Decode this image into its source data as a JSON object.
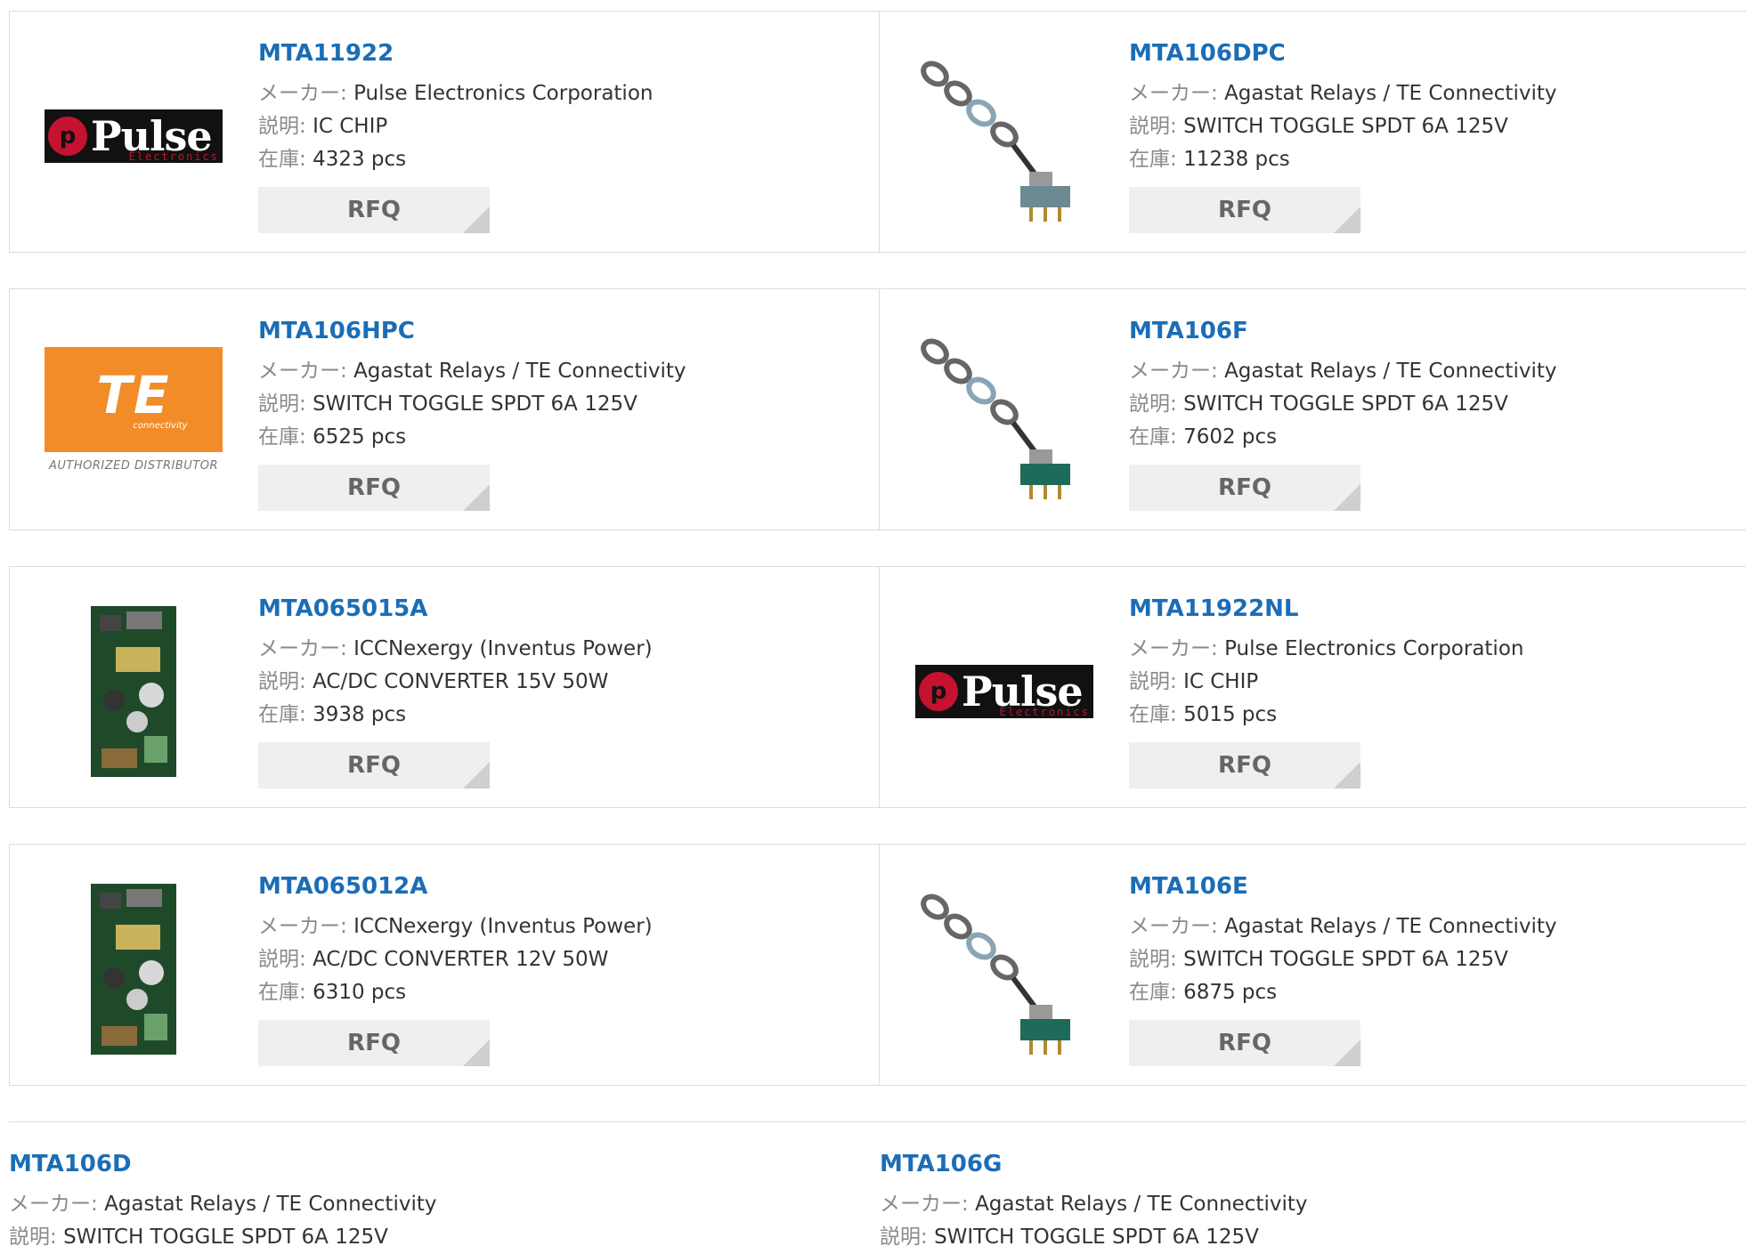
{
  "labels": {
    "maker": "メーカー:",
    "desc": "説明:",
    "stock": "在庫:",
    "rfq": "RFQ"
  },
  "products": [
    {
      "pn": "MTA11922",
      "maker": "Pulse Electronics Corporation",
      "desc": "IC CHIP",
      "stock": "4323 pcs",
      "thumb": "pulse-logo",
      "thumb_text": "Pulse",
      "thumb_sub": "Electronics"
    },
    {
      "pn": "MTA106DPC",
      "maker": "Agastat Relays / TE Connectivity",
      "desc": "SWITCH TOGGLE SPDT 6A 125V",
      "stock": "11238 pcs",
      "thumb": "toggle-switch-photo-gray"
    },
    {
      "pn": "MTA106HPC",
      "maker": "Agastat Relays / TE Connectivity",
      "desc": "SWITCH TOGGLE SPDT 6A 125V",
      "stock": "6525 pcs",
      "thumb": "te-logo",
      "thumb_text": "TE",
      "thumb_sub": "connectivity",
      "thumb_caption": "AUTHORIZED DISTRIBUTOR"
    },
    {
      "pn": "MTA106F",
      "maker": "Agastat Relays / TE Connectivity",
      "desc": "SWITCH TOGGLE SPDT 6A 125V",
      "stock": "7602 pcs",
      "thumb": "toggle-switch-photo-green"
    },
    {
      "pn": "MTA065015A",
      "maker": "ICCNexergy (Inventus Power)",
      "desc": "AC/DC CONVERTER 15V 50W",
      "stock": "3938 pcs",
      "thumb": "pcb-photo"
    },
    {
      "pn": "MTA11922NL",
      "maker": "Pulse Electronics Corporation",
      "desc": "IC CHIP",
      "stock": "5015 pcs",
      "thumb": "pulse-logo",
      "thumb_text": "Pulse",
      "thumb_sub": "Electronics"
    },
    {
      "pn": "MTA065012A",
      "maker": "ICCNexergy (Inventus Power)",
      "desc": "AC/DC CONVERTER 12V 50W",
      "stock": "6310 pcs",
      "thumb": "pcb-photo"
    },
    {
      "pn": "MTA106E",
      "maker": "Agastat Relays / TE Connectivity",
      "desc": "SWITCH TOGGLE SPDT 6A 125V",
      "stock": "6875 pcs",
      "thumb": "toggle-switch-photo-green"
    },
    {
      "pn": "MTA106D",
      "maker": "Agastat Relays / TE Connectivity",
      "desc": "SWITCH TOGGLE SPDT 6A 125V",
      "stock": "",
      "thumb": ""
    },
    {
      "pn": "MTA106G",
      "maker": "Agastat Relays / TE Connectivity",
      "desc": "SWITCH TOGGLE SPDT 6A 125V",
      "stock": "",
      "thumb": ""
    }
  ],
  "colors": {
    "link": "#1b6db6",
    "border": "#dcdcdc",
    "rfq_bg": "#efefef",
    "pulse_red": "#c41230",
    "te_orange": "#f28c28"
  }
}
